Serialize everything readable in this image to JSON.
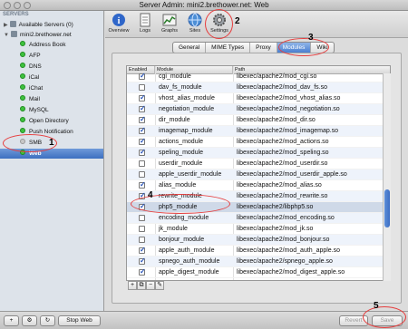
{
  "window": {
    "title": "Server Admin: mini2.brethower.net: Web"
  },
  "sidebar": {
    "header": "SERVERS",
    "items": [
      {
        "label": "Available Servers (0)"
      },
      {
        "label": "mini2.brethower.net"
      },
      {
        "label": "Address Book"
      },
      {
        "label": "AFP"
      },
      {
        "label": "DNS"
      },
      {
        "label": "iCal"
      },
      {
        "label": "iChat"
      },
      {
        "label": "Mail"
      },
      {
        "label": "MySQL"
      },
      {
        "label": "Open Directory"
      },
      {
        "label": "Push Notification"
      },
      {
        "label": "SMB"
      },
      {
        "label": "Web"
      }
    ]
  },
  "toolbar": {
    "buttons": [
      {
        "label": "Overview"
      },
      {
        "label": "Logs"
      },
      {
        "label": "Graphs"
      },
      {
        "label": "Sites"
      },
      {
        "label": "Settings"
      }
    ]
  },
  "tabs": [
    {
      "label": "General"
    },
    {
      "label": "MIME Types"
    },
    {
      "label": "Proxy"
    },
    {
      "label": "Modules"
    },
    {
      "label": "Wiki"
    }
  ],
  "table": {
    "headers": {
      "enabled": "Enabled",
      "module": "Module",
      "path": "Path"
    },
    "rows": [
      {
        "module": "cgi_module",
        "path": "libexec/apache2/mod_cgi.so",
        "enabled": true
      },
      {
        "module": "dav_fs_module",
        "path": "libexec/apache2/mod_dav_fs.so",
        "enabled": false
      },
      {
        "module": "vhost_alias_module",
        "path": "libexec/apache2/mod_vhost_alias.so",
        "enabled": true
      },
      {
        "module": "negotiation_module",
        "path": "libexec/apache2/mod_negotiation.so",
        "enabled": true
      },
      {
        "module": "dir_module",
        "path": "libexec/apache2/mod_dir.so",
        "enabled": true
      },
      {
        "module": "imagemap_module",
        "path": "libexec/apache2/mod_imagemap.so",
        "enabled": true
      },
      {
        "module": "actions_module",
        "path": "libexec/apache2/mod_actions.so",
        "enabled": true
      },
      {
        "module": "speling_module",
        "path": "libexec/apache2/mod_speling.so",
        "enabled": true
      },
      {
        "module": "userdir_module",
        "path": "libexec/apache2/mod_userdir.so",
        "enabled": false
      },
      {
        "module": "apple_userdir_module",
        "path": "libexec/apache2/mod_userdir_apple.so",
        "enabled": false
      },
      {
        "module": "alias_module",
        "path": "libexec/apache2/mod_alias.so",
        "enabled": true
      },
      {
        "module": "rewrite_module",
        "path": "libexec/apache2/mod_rewrite.so",
        "enabled": true
      },
      {
        "module": "php5_module",
        "path": "libexec/apache2/libphp5.so",
        "enabled": true
      },
      {
        "module": "encoding_module",
        "path": "libexec/apache2/mod_encoding.so",
        "enabled": false
      },
      {
        "module": "jk_module",
        "path": "libexec/apache2/mod_jk.so",
        "enabled": false
      },
      {
        "module": "bonjour_module",
        "path": "libexec/apache2/mod_bonjour.so",
        "enabled": false
      },
      {
        "module": "apple_auth_module",
        "path": "libexec/apache2/mod_auth_apple.so",
        "enabled": true
      },
      {
        "module": "spnego_auth_module",
        "path": "libexec/apache2/spnego_apple.so",
        "enabled": true
      },
      {
        "module": "apple_digest_module",
        "path": "libexec/apache2/mod_digest_apple.so",
        "enabled": true
      }
    ]
  },
  "table_buttons": {
    "add": "+",
    "duplicate": "⧉",
    "remove": "−",
    "edit": "✎"
  },
  "bottom": {
    "add": "+",
    "gear": "⚙",
    "refresh": "↻",
    "stop_web": "Stop Web",
    "revert": "Revert",
    "save": "Save"
  },
  "annotations": [
    "1",
    "2",
    "3",
    "4",
    "5"
  ]
}
